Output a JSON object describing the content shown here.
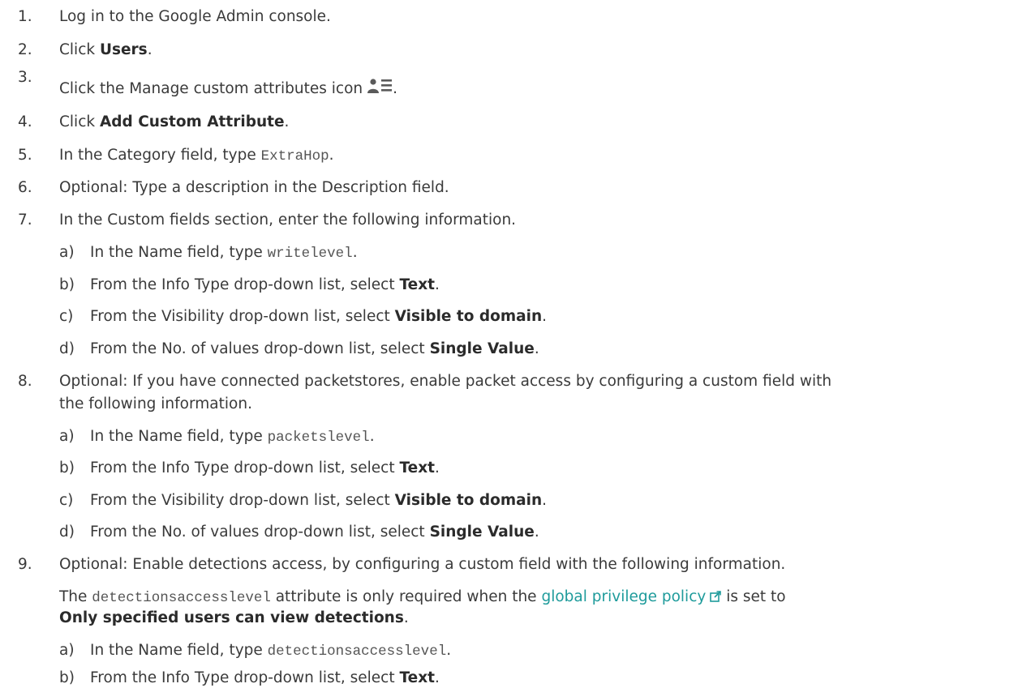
{
  "steps": [
    {
      "num": "1.",
      "text": "Log in to the Google Admin console."
    },
    {
      "num": "2.",
      "pre": "Click ",
      "bold": "Users",
      "post": "."
    },
    {
      "num": "3.",
      "pre": "Click the Manage custom attributes icon",
      "icon": "manage-custom-attributes-icon",
      "post": "."
    },
    {
      "num": "4.",
      "pre": "Click ",
      "bold": "Add Custom Attribute",
      "post": "."
    },
    {
      "num": "5.",
      "pre": "In the Category field, type ",
      "code": "ExtraHop",
      "post": "."
    },
    {
      "num": "6.",
      "text": "Optional: Type a description in the Description field."
    },
    {
      "num": "7.",
      "text": "In the Custom fields section, enter the following information.",
      "substeps": [
        {
          "letter": "a)",
          "pre": "In the Name field, type ",
          "code": "writelevel",
          "post": "."
        },
        {
          "letter": "b)",
          "pre": "From the Info Type drop-down list, select ",
          "bold": "Text",
          "post": "."
        },
        {
          "letter": "c)",
          "pre": "From the Visibility drop-down list, select ",
          "bold": "Visible to domain",
          "post": "."
        },
        {
          "letter": "d)",
          "pre": "From the No. of values drop-down list, select ",
          "bold": "Single Value",
          "post": "."
        }
      ]
    },
    {
      "num": "8.",
      "line1": "Optional: If you have connected packetstores, enable packet access by configuring a custom field with",
      "line2": "the following information.",
      "substeps": [
        {
          "letter": "a)",
          "pre": "In the Name field, type ",
          "code": "packetslevel",
          "post": "."
        },
        {
          "letter": "b)",
          "pre": "From the Info Type drop-down list, select ",
          "bold": "Text",
          "post": "."
        },
        {
          "letter": "c)",
          "pre": "From the Visibility drop-down list, select ",
          "bold": "Visible to domain",
          "post": "."
        },
        {
          "letter": "d)",
          "pre": "From the No. of values drop-down list, select ",
          "bold": "Single Value",
          "post": "."
        }
      ]
    },
    {
      "num": "9.",
      "text": "Optional: Enable detections access, by configuring a custom field with the following information.",
      "note": {
        "pre": "The ",
        "code": "detectionsaccesslevel",
        "mid": " attribute is only required when the ",
        "link": "global privilege policy",
        "post_link": " is set to",
        "bold_line2": "Only specified users can view detections",
        "end": "."
      },
      "substeps": [
        {
          "letter": "a)",
          "pre": "In the Name field, type ",
          "code": "detectionsaccesslevel",
          "post": "."
        },
        {
          "letter": "b)",
          "pre": "From the Info Type drop-down list, select ",
          "bold": "Text",
          "post": "."
        }
      ]
    }
  ],
  "colors": {
    "text": "#3a3a3a",
    "link": "#1e9b9b",
    "code": "#555555"
  }
}
